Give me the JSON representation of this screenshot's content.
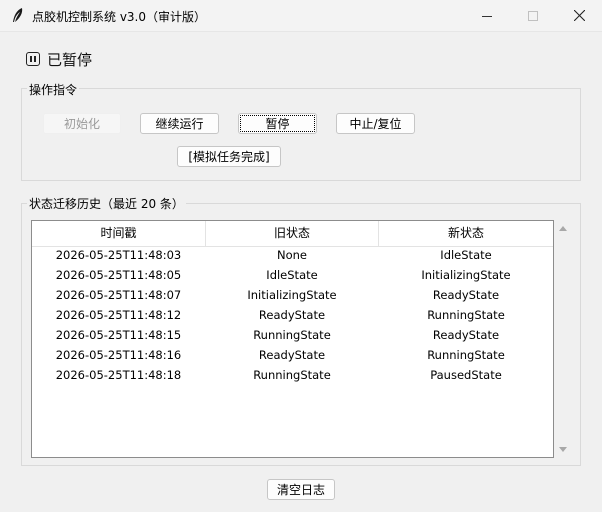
{
  "window": {
    "title": "点胶机控制系统 v3.0（审计版）",
    "icon": "feather-icon"
  },
  "status": {
    "icon": "pause-icon",
    "text": "已暂停"
  },
  "operations": {
    "group_label": "操作指令",
    "buttons": {
      "init": "初始化",
      "resume": "继续运行",
      "pause": "暂停",
      "stop_reset": "中止/复位",
      "simulate_complete": "[模拟任务完成]"
    }
  },
  "history": {
    "group_label": "状态迁移历史（最近 20 条）",
    "columns": [
      "时间戳",
      "旧状态",
      "新状态"
    ],
    "rows": [
      [
        "2026-05-25T11:48:03",
        "None",
        "IdleState"
      ],
      [
        "2026-05-25T11:48:05",
        "IdleState",
        "InitializingState"
      ],
      [
        "2026-05-25T11:48:07",
        "InitializingState",
        "ReadyState"
      ],
      [
        "2026-05-25T11:48:12",
        "ReadyState",
        "RunningState"
      ],
      [
        "2026-05-25T11:48:15",
        "RunningState",
        "ReadyState"
      ],
      [
        "2026-05-25T11:48:16",
        "ReadyState",
        "RunningState"
      ],
      [
        "2026-05-25T11:48:18",
        "RunningState",
        "PausedState"
      ]
    ]
  },
  "footer": {
    "clear_log": "清空日志"
  }
}
